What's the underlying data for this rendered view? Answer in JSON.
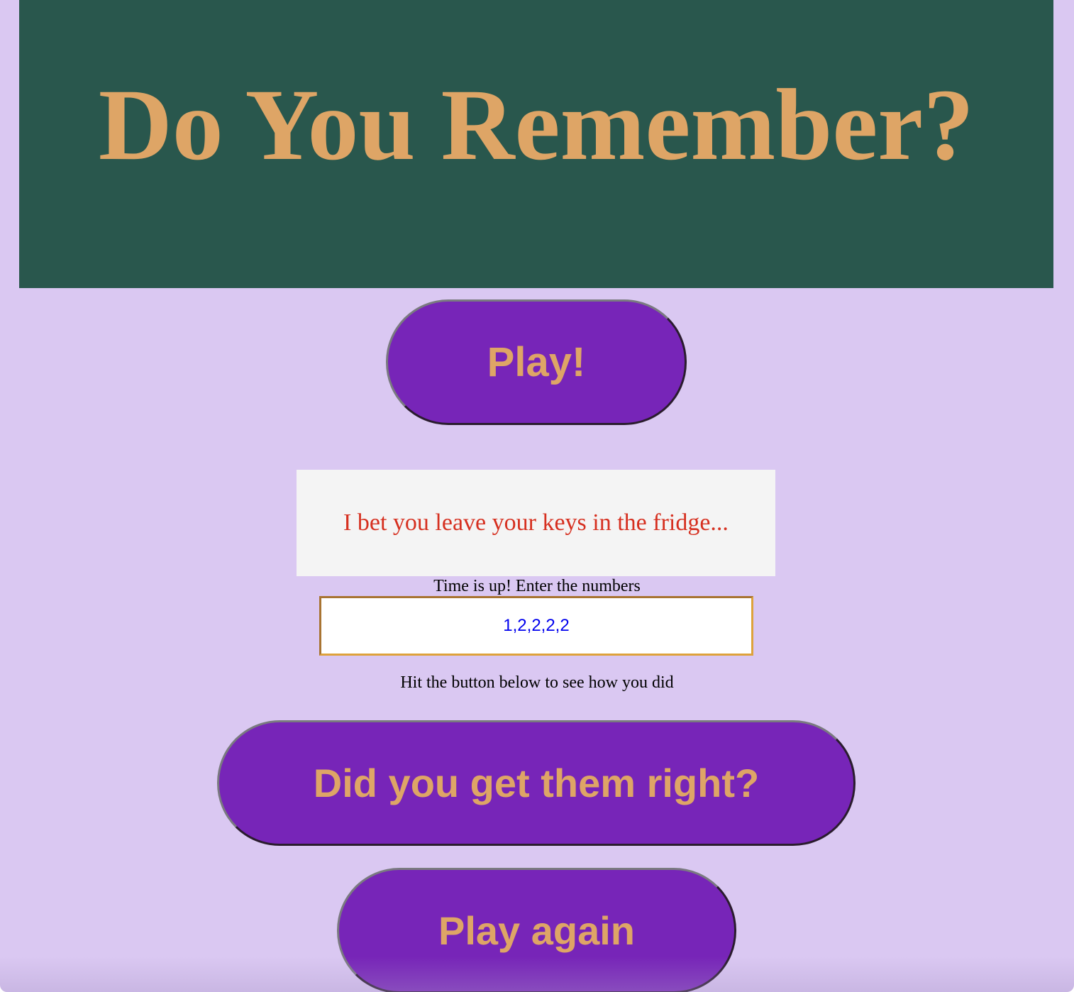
{
  "header": {
    "title": "Do You Remember?"
  },
  "play_button": {
    "label": "Play!"
  },
  "message": {
    "text": "I bet you leave your keys in the fridge..."
  },
  "prompt": {
    "text": "Time is up! Enter the numbers"
  },
  "answer_input": {
    "value": "1,2,2,2,2"
  },
  "hint": {
    "text": "Hit the button below to see how you did"
  },
  "check_button": {
    "label": "Did you get them right?"
  },
  "again_button": {
    "label": "Play again"
  },
  "colors": {
    "background": "#dac8f2",
    "header_bg": "#29574d",
    "accent_gold": "#dea566",
    "button_purple": "#7725b8",
    "message_red": "#d63020",
    "input_text_blue": "#0000ee"
  }
}
